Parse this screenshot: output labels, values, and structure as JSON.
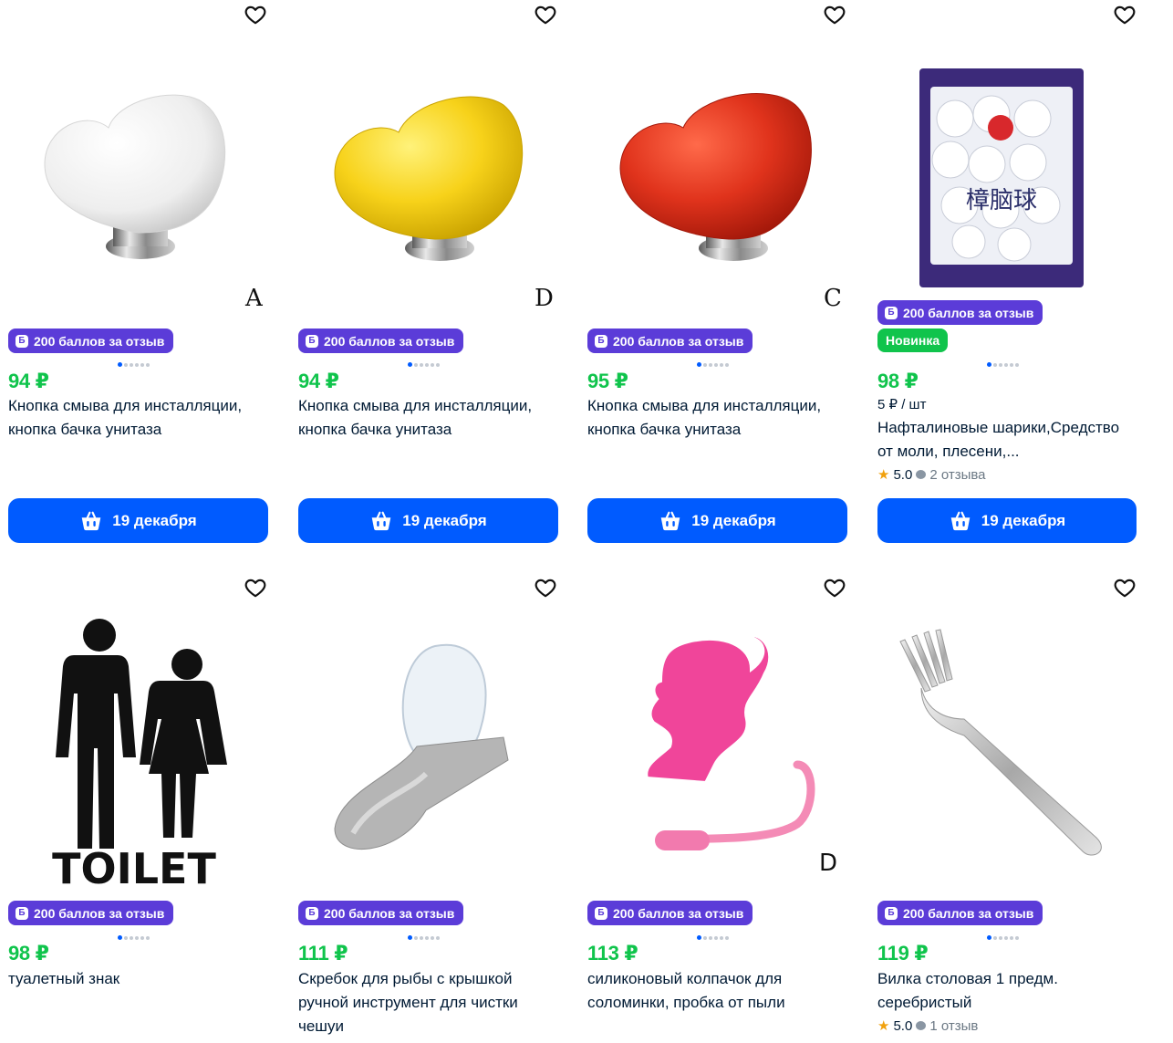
{
  "colors": {
    "accent": "#005bff",
    "price": "#10c44c",
    "badge": "#5b3cd8",
    "new_badge": "#10c44c"
  },
  "icons": {
    "favorite": "heart-outline-icon",
    "cart": "basket-icon",
    "star": "star-icon",
    "reviews": "speech-bubble-icon",
    "badge": "points-icon"
  },
  "products": [
    {
      "price": "94 ₽",
      "title_1": "Кнопка смыва для инсталляции,",
      "title_2": "кнопка бачка унитаза",
      "badge": "200 баллов за отзыв",
      "badge_icon": "Б",
      "button": "19 декабря",
      "overlay": "A",
      "image": "white heart flush button"
    },
    {
      "price": "94 ₽",
      "title_1": "Кнопка смыва для инсталляции,",
      "title_2": "кнопка бачка унитаза",
      "badge": "200 баллов за отзыв",
      "badge_icon": "Б",
      "button": "19 декабря",
      "overlay": "D",
      "image": "yellow heart flush button"
    },
    {
      "price": "95 ₽",
      "title_1": "Кнопка смыва для инсталляции,",
      "title_2": "кнопка бачка унитаза",
      "badge": "200 баллов за отзыв",
      "badge_icon": "Б",
      "button": "19 декабря",
      "overlay": "C",
      "image": "red heart flush button"
    },
    {
      "price": "98 ₽",
      "unit": "5 ₽ / шт",
      "title_1": "Нафталиновые шарики,Средство",
      "title_2": "от моли, плесени,...",
      "badge": "200 баллов за отзыв",
      "badge_icon": "Б",
      "new": "Новинка",
      "rating": "5.0",
      "reviews": "2 отзыва",
      "button": "19 декабря",
      "package_text": "樟脑球",
      "image": "mothballs package"
    },
    {
      "price": "98 ₽",
      "title_1": "туалетный знак",
      "badge": "200 баллов за отзыв",
      "badge_icon": "Б",
      "sign_text": "TOILET",
      "image": "toilet sign sticker"
    },
    {
      "price": "111 ₽",
      "title_1": "Скребок для рыбы с крышкой",
      "title_2": "ручной инструмент для чистки",
      "title_3": "чешуи",
      "badge": "200 баллов за отзыв",
      "badge_icon": "Б",
      "image": "fish scale scraper"
    },
    {
      "price": "113 ₽",
      "title_1": "силиконовый колпачок для",
      "title_2": "соломинки, пробка от пыли",
      "badge": "200 баллов за отзыв",
      "badge_icon": "Б",
      "overlay": "D",
      "image": "pink silicone straw cap"
    },
    {
      "price": "119 ₽",
      "title_1": "Вилка столовая 1 предм.",
      "title_2": "серебристый",
      "badge": "200 баллов за отзыв",
      "badge_icon": "Б",
      "rating": "5.0",
      "reviews": "1 отзыв",
      "image": "silver table fork"
    }
  ]
}
